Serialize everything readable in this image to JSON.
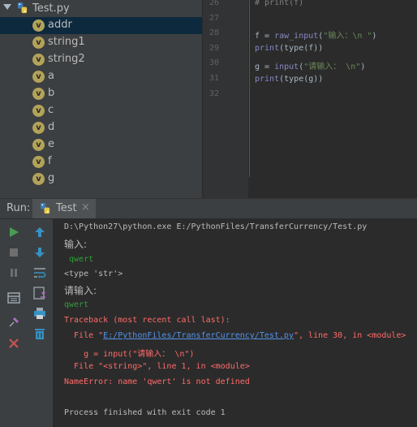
{
  "structure": {
    "root_label": "Test.py",
    "badge_letter": "v",
    "items": [
      "addr",
      "string1",
      "string2",
      "a",
      "b",
      "c",
      "d",
      "e",
      "f",
      "g"
    ],
    "selected_item": "addr"
  },
  "editor": {
    "line_numbers": [
      "26",
      "27",
      "28",
      "29",
      "30",
      "31",
      "32"
    ],
    "line26": "# print(f)",
    "line28": {
      "var": "f = ",
      "fn": "raw_input",
      "open": "(",
      "str": "\"输入：\\n \"",
      "close": ")"
    },
    "line29": {
      "fn": "print",
      "rest": "(type(f))"
    },
    "line30": {
      "var": "g = ",
      "fn": "input",
      "open": "(",
      "str": "\"请输入： \\n\"",
      "close": ")"
    },
    "line31": {
      "fn": "print",
      "rest": "(type(g))"
    }
  },
  "run_panel": {
    "title": "Run:",
    "tab_label": "Test",
    "tab_close": "×"
  },
  "console": {
    "cmd": "D:\\Python27\\python.exe E:/PythonFiles/TransferCurrency/Test.py",
    "prompt1": "输入:",
    "input1": " qwert",
    "type_out": "<type 'str'>",
    "prompt2": "请输入:",
    "input2": "qwert",
    "traceback": "Traceback (most recent call last):",
    "file1_prefix": "  File \"",
    "file1_link": "E:/PythonFiles/TransferCurrency/Test.py",
    "file1_suffix": "\", line 30, in <module>",
    "code_line": "    g = input(\"请输入： \\n\")",
    "file2": "  File \"<string>\", line 1, in <module>",
    "error": "NameError: name 'qwert' is not defined",
    "finished": "Process finished with exit code 1"
  },
  "colors": {
    "accent_selection": "#0d293e",
    "error_text": "#ff6b68",
    "input_text": "#2f9f3a",
    "link": "#5394ec"
  }
}
